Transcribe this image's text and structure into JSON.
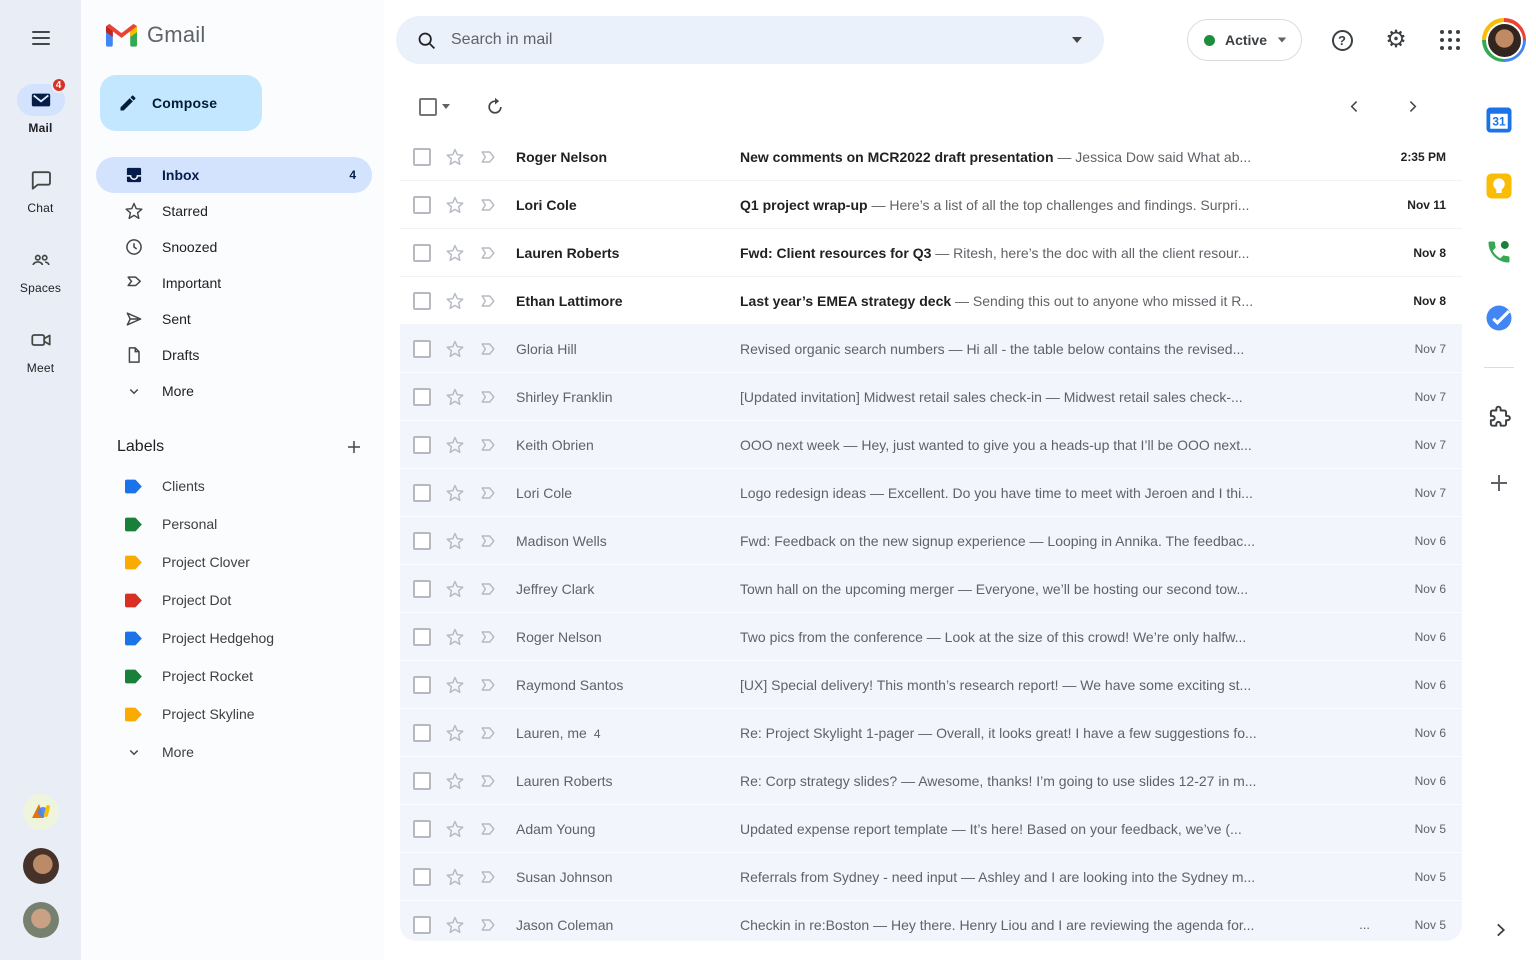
{
  "app": {
    "wordmark": "Gmail"
  },
  "ui": {
    "separator": " — "
  },
  "left_rail": {
    "items": [
      {
        "name": "mail",
        "label": "Mail",
        "badge": "4",
        "active": true
      },
      {
        "name": "chat",
        "label": "Chat",
        "active": false
      },
      {
        "name": "spaces",
        "label": "Spaces",
        "active": false
      },
      {
        "name": "meet",
        "label": "Meet",
        "active": false
      }
    ]
  },
  "sidebar": {
    "compose_label": "Compose",
    "nav": [
      {
        "icon": "inbox",
        "label": "Inbox",
        "count": "4",
        "selected": true
      },
      {
        "icon": "star",
        "label": "Starred"
      },
      {
        "icon": "clock",
        "label": "Snoozed"
      },
      {
        "icon": "important",
        "label": "Important"
      },
      {
        "icon": "send",
        "label": "Sent"
      },
      {
        "icon": "draft",
        "label": "Drafts"
      },
      {
        "icon": "chevron-down",
        "label": "More"
      }
    ],
    "labels_header": "Labels",
    "labels": [
      {
        "name": "Clients",
        "color": "#1a73e8"
      },
      {
        "name": "Personal",
        "color": "#188038"
      },
      {
        "name": "Project Clover",
        "color": "#f9ab00"
      },
      {
        "name": "Project Dot",
        "color": "#d93025"
      },
      {
        "name": "Project Hedgehog",
        "color": "#1a73e8"
      },
      {
        "name": "Project Rocket",
        "color": "#188038"
      },
      {
        "name": "Project Skyline",
        "color": "#f9ab00"
      }
    ],
    "labels_more": "More"
  },
  "topbar": {
    "search_placeholder": "Search in mail",
    "status_label": "Active"
  },
  "colors": {
    "selected_pill": "#d3e3fd",
    "compose_bg": "#c2e7ff",
    "unread_badge": "#d93025",
    "active_dot": "#1e8e3e",
    "read_row_bg": "#f2f6fc"
  },
  "emails": [
    {
      "sender": "Roger Nelson",
      "subject": "New comments on MCR2022 draft presentation",
      "snippet": "Jessica Dow said What ab...",
      "date": "2:35 PM",
      "unread": true
    },
    {
      "sender": "Lori Cole",
      "subject": "Q1 project wrap-up",
      "snippet": "Here’s a list of all the top challenges and findings. Surpri...",
      "date": "Nov 11",
      "unread": true
    },
    {
      "sender": "Lauren Roberts",
      "subject": "Fwd: Client resources for Q3",
      "snippet": "Ritesh, here’s the doc with all the client resour...",
      "date": "Nov 8",
      "unread": true
    },
    {
      "sender": "Ethan Lattimore",
      "subject": "Last year’s EMEA strategy deck",
      "snippet": "Sending this out to anyone who missed it R...",
      "date": "Nov 8",
      "unread": true
    },
    {
      "sender": "Gloria Hill",
      "subject": "Revised organic search numbers",
      "snippet": "Hi all - the table below contains the revised...",
      "date": "Nov 7",
      "unread": false
    },
    {
      "sender": "Shirley Franklin",
      "subject": "[Updated invitation] Midwest retail sales check-in",
      "snippet": "Midwest retail sales check-...",
      "date": "Nov 7",
      "unread": false
    },
    {
      "sender": "Keith Obrien",
      "subject": "OOO next week",
      "snippet": "Hey, just wanted to give you a heads-up that I’ll be OOO next...",
      "date": "Nov 7",
      "unread": false
    },
    {
      "sender": "Lori Cole",
      "subject": "Logo redesign ideas",
      "snippet": "Excellent. Do you have time to meet with Jeroen and I thi...",
      "date": "Nov 7",
      "unread": false
    },
    {
      "sender": "Madison Wells",
      "subject": "Fwd: Feedback on the new signup experience",
      "snippet": "Looping in Annika. The feedbac...",
      "date": "Nov 6",
      "unread": false
    },
    {
      "sender": "Jeffrey Clark",
      "subject": "Town hall on the upcoming merger",
      "snippet": "Everyone, we’ll be hosting our second tow...",
      "date": "Nov 6",
      "unread": false
    },
    {
      "sender": "Roger Nelson",
      "subject": "Two pics from the conference",
      "snippet": "Look at the size of this crowd! We’re only halfw...",
      "date": "Nov 6",
      "unread": false
    },
    {
      "sender": "Raymond Santos",
      "subject": "[UX] Special delivery! This month’s research report!",
      "snippet": "We have some exciting st...",
      "date": "Nov 6",
      "unread": false
    },
    {
      "sender": "Lauren, me",
      "thread_count": "4",
      "subject": "Re: Project Skylight 1-pager",
      "snippet": "Overall, it looks great! I have a few suggestions fo...",
      "date": "Nov 6",
      "unread": false
    },
    {
      "sender": "Lauren Roberts",
      "subject": "Re: Corp strategy slides?",
      "snippet": "Awesome, thanks! I’m going to use slides 12-27 in m...",
      "date": "Nov 6",
      "unread": false
    },
    {
      "sender": "Adam Young",
      "subject": "Updated expense report template",
      "snippet": "It’s here! Based on your feedback, we’ve (...",
      "date": "Nov 5",
      "unread": false
    },
    {
      "sender": "Susan Johnson",
      "subject": "Referrals from Sydney - need input",
      "snippet": "Ashley and I are looking into the Sydney m...",
      "date": "Nov 5",
      "unread": false
    },
    {
      "sender": "Jason Coleman",
      "subject": "Checkin in re:Boston",
      "snippet": "Hey there. Henry Liou and I are reviewing the agenda for...",
      "suffix": "...",
      "date": "Nov 5",
      "unread": false
    }
  ],
  "right_rail": {
    "icons": [
      {
        "name": "calendar",
        "label_text": "31"
      },
      {
        "name": "keep"
      },
      {
        "name": "voice"
      },
      {
        "name": "tasks"
      },
      {
        "name": "divider"
      },
      {
        "name": "addons"
      },
      {
        "name": "add"
      }
    ]
  }
}
